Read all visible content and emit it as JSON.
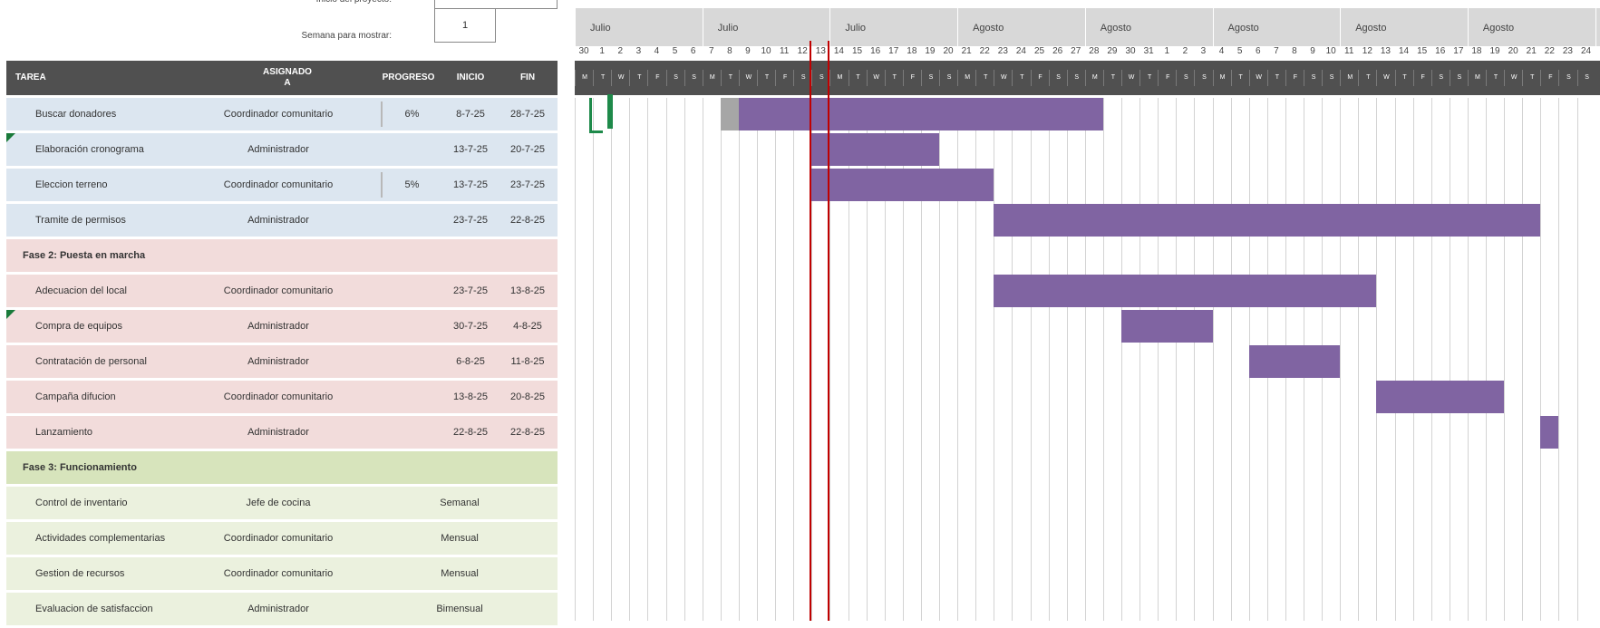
{
  "header": {
    "project_start_label": "Inicio del proyecto:",
    "project_start_value": "",
    "week_label": "Semana para mostrar:",
    "week_value": "1"
  },
  "columns": {
    "task": "TAREA",
    "assigned": "ASIGNADO\nA",
    "progress": "PROGRESO",
    "start": "INICIO",
    "end": "FIN"
  },
  "rows": [
    {
      "type": "task",
      "color": "blue",
      "name": "Buscar donadores",
      "assigned": "Coordinador comunitario",
      "progress": "6%",
      "start": "8-7-25",
      "end": "28-7-25"
    },
    {
      "type": "task",
      "color": "blue",
      "name": "Elaboración cronograma",
      "assigned": "Administrador",
      "progress": "",
      "start": "13-7-25",
      "end": "20-7-25"
    },
    {
      "type": "task",
      "color": "blue",
      "name": "Eleccion terreno",
      "assigned": "Coordinador comunitario",
      "progress": "5%",
      "start": "13-7-25",
      "end": "23-7-25"
    },
    {
      "type": "task",
      "color": "blue",
      "name": "Tramite de permisos",
      "assigned": "Administrador",
      "progress": "",
      "start": "23-7-25",
      "end": "22-8-25"
    },
    {
      "type": "phase",
      "color": "pink",
      "name": "Fase 2: Puesta en marcha"
    },
    {
      "type": "task",
      "color": "pink",
      "name": "Adecuacion del local",
      "assigned": "Coordinador comunitario",
      "progress": "",
      "start": "23-7-25",
      "end": "13-8-25"
    },
    {
      "type": "task",
      "color": "pink",
      "name": "Compra de equipos",
      "assigned": "Administrador",
      "progress": "",
      "start": "30-7-25",
      "end": "4-8-25"
    },
    {
      "type": "task",
      "color": "pink",
      "name": "Contratación de personal",
      "assigned": "Administrador",
      "progress": "",
      "start": "6-8-25",
      "end": "11-8-25"
    },
    {
      "type": "task",
      "color": "pink",
      "name": "Campaña difucion",
      "assigned": "Coordinador comunitario",
      "progress": "",
      "start": "13-8-25",
      "end": "20-8-25"
    },
    {
      "type": "task",
      "color": "pink",
      "name": "Lanzamiento",
      "assigned": "Administrador",
      "progress": "",
      "start": "22-8-25",
      "end": "22-8-25"
    },
    {
      "type": "phase",
      "color": "greenh",
      "name": "Fase 3: Funcionamiento"
    },
    {
      "type": "freq",
      "color": "greenl",
      "name": "Control de inventario",
      "assigned": "Jefe de cocina",
      "frequency": "Semanal"
    },
    {
      "type": "freq",
      "color": "greenl",
      "name": "Actividades complementarias",
      "assigned": "Coordinador comunitario",
      "frequency": "Mensual"
    },
    {
      "type": "freq",
      "color": "greenl",
      "name": "Gestion de recursos",
      "assigned": "Coordinador comunitario",
      "frequency": "Mensual"
    },
    {
      "type": "freq",
      "color": "greenl",
      "name": "Evaluacion de satisfaccion",
      "assigned": "Administrador",
      "frequency": "Bimensual"
    }
  ],
  "timeline": {
    "months": [
      "Julio",
      "Julio",
      "Julio",
      "Agosto",
      "Agosto",
      "Agosto",
      "Agosto",
      "Agosto",
      "Agosto"
    ],
    "days": [
      "30",
      "1",
      "2",
      "3",
      "4",
      "5",
      "6",
      "7",
      "8",
      "9",
      "10",
      "11",
      "12",
      "13",
      "14",
      "15",
      "16",
      "17",
      "18",
      "19",
      "20",
      "21",
      "22",
      "23",
      "24",
      "25",
      "26",
      "27",
      "28",
      "29",
      "30",
      "31",
      "1",
      "2",
      "3",
      "4",
      "5",
      "6",
      "7",
      "8",
      "9",
      "10",
      "11",
      "12",
      "13",
      "14",
      "15",
      "16",
      "17",
      "18",
      "19",
      "20",
      "21",
      "22",
      "23",
      "24"
    ],
    "weekday_letters": [
      "M",
      "T",
      "W",
      "T",
      "F",
      "S",
      "S"
    ],
    "bar_color": "#8064a2",
    "today_line_color": "#c00000"
  }
}
